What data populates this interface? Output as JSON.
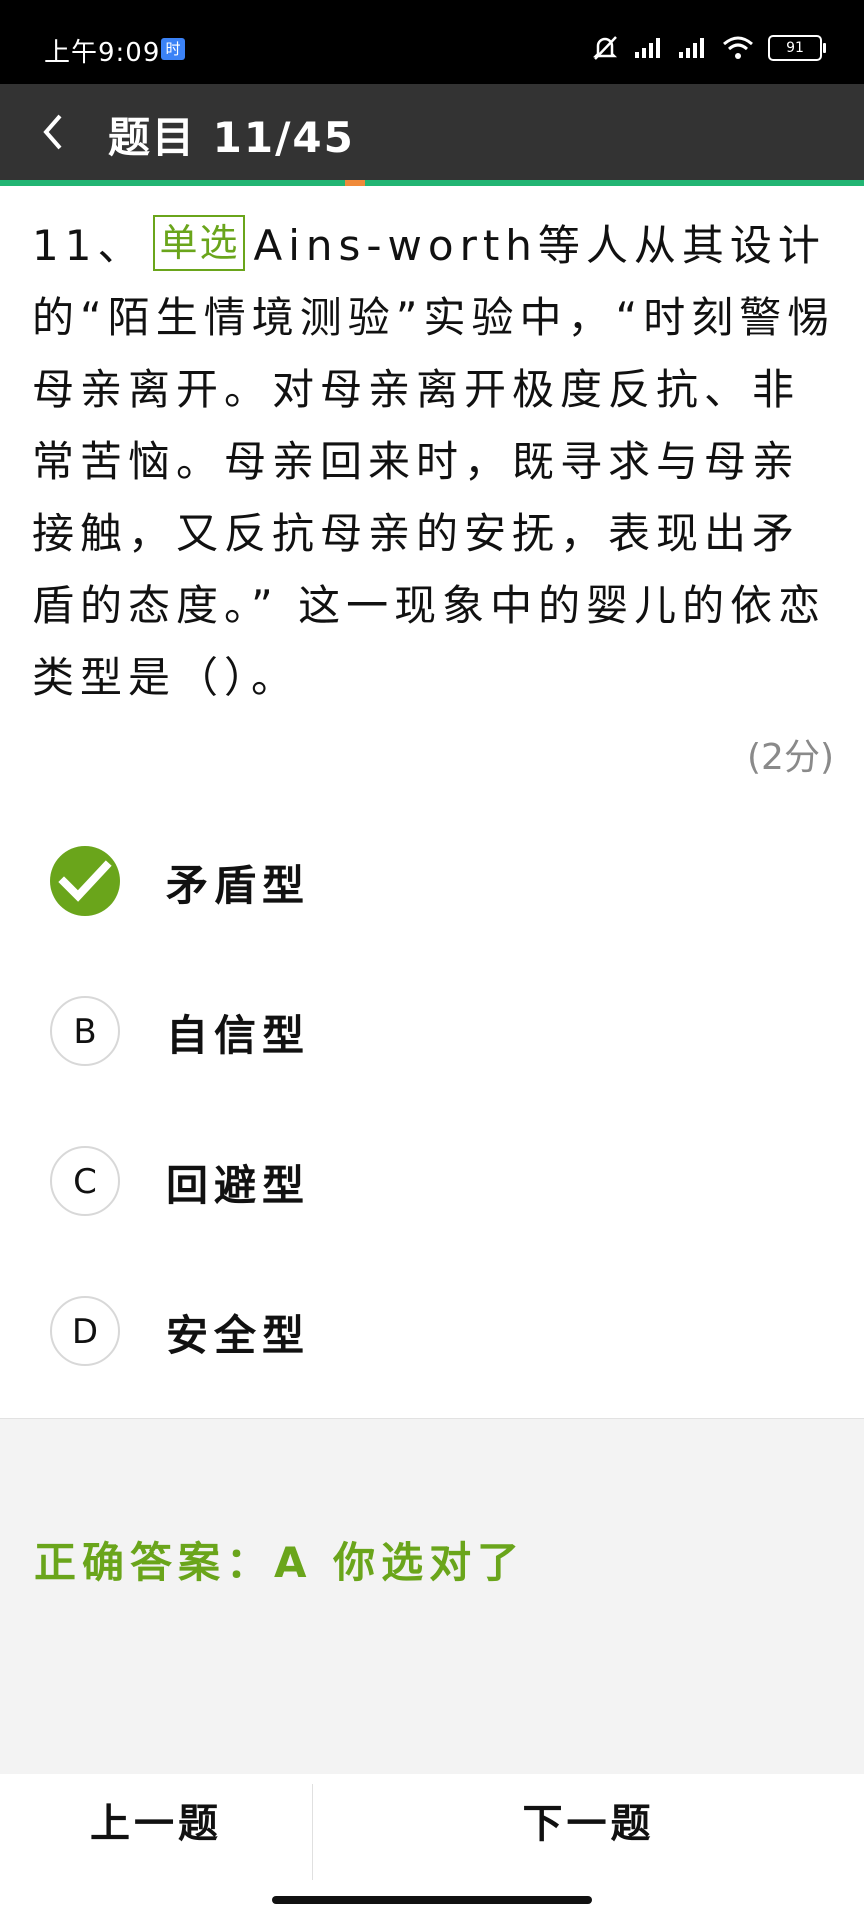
{
  "status_bar": {
    "time": "上午9:09",
    "badge": "时",
    "battery": "91"
  },
  "header": {
    "title": "题目 11/45"
  },
  "question": {
    "number": "11、",
    "type_tag": "单选",
    "text": "Ains-worth等人从其设计的“陌生情境测验”实验中，“时刻警惕母亲离开。对母亲离开极度反抗、非常苦恼。母亲回来时，既寻求与母亲接触，又反抗母亲的安抚，表现出矛盾的态度。” 这一现象中的婴儿的依恋类型是（）。",
    "score": "(2分)"
  },
  "options": [
    {
      "letter": "A",
      "text": "矛盾型",
      "selected": true
    },
    {
      "letter": "B",
      "text": "自信型",
      "selected": false
    },
    {
      "letter": "C",
      "text": "回避型",
      "selected": false
    },
    {
      "letter": "D",
      "text": "安全型",
      "selected": false
    }
  ],
  "answer": {
    "text": "正确答案：A  你选对了"
  },
  "nav": {
    "prev": "上一题",
    "next": "下一题"
  },
  "colors": {
    "accent_green": "#6aa51b",
    "header_bg": "#333333",
    "progress_green": "#22b573",
    "progress_marker": "#f08a3a"
  }
}
